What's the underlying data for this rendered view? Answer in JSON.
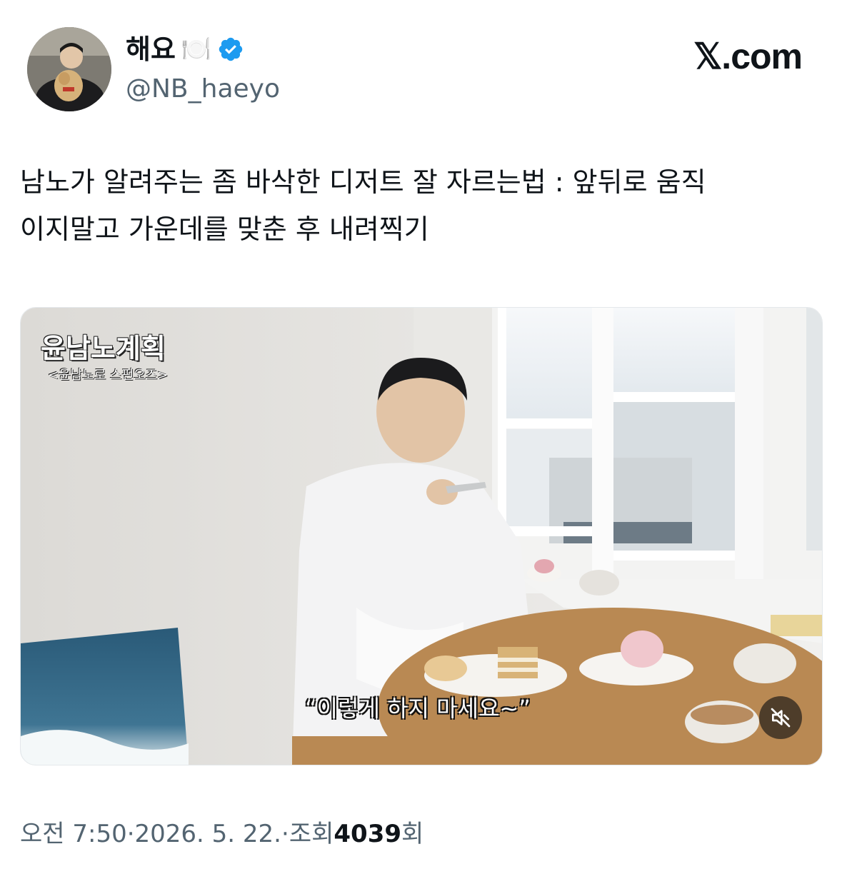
{
  "author": {
    "display_name": "해요",
    "name_emoji": "🍽️",
    "handle": "@NB_haeyo",
    "verified": true
  },
  "brand": "𝕏.com",
  "tweet": {
    "lines": [
      "남노가 알려주는 좀 바삭한 디저트 잘 자르는법 : 앞뒤로 움직",
      "이지말고 가운데를 맞춘 후 내려찍기"
    ]
  },
  "media": {
    "overlay_title": "윤남노계획",
    "overlay_subtitle": "<윤남노로 스펀오즈>",
    "caption": "“이렇게 하지 마세요~”",
    "mute_icon": "speaker-muted-icon"
  },
  "meta": {
    "time": "오전 7:50",
    "sep1": " · ",
    "date": "2026. 5. 22.",
    "sep2": " · ",
    "views_label": "조회 ",
    "views_count": "4039",
    "views_suffix": "회"
  },
  "colors": {
    "verified_blue": "#1d9bf0",
    "text_primary": "#0f1419",
    "text_secondary": "#536471"
  }
}
